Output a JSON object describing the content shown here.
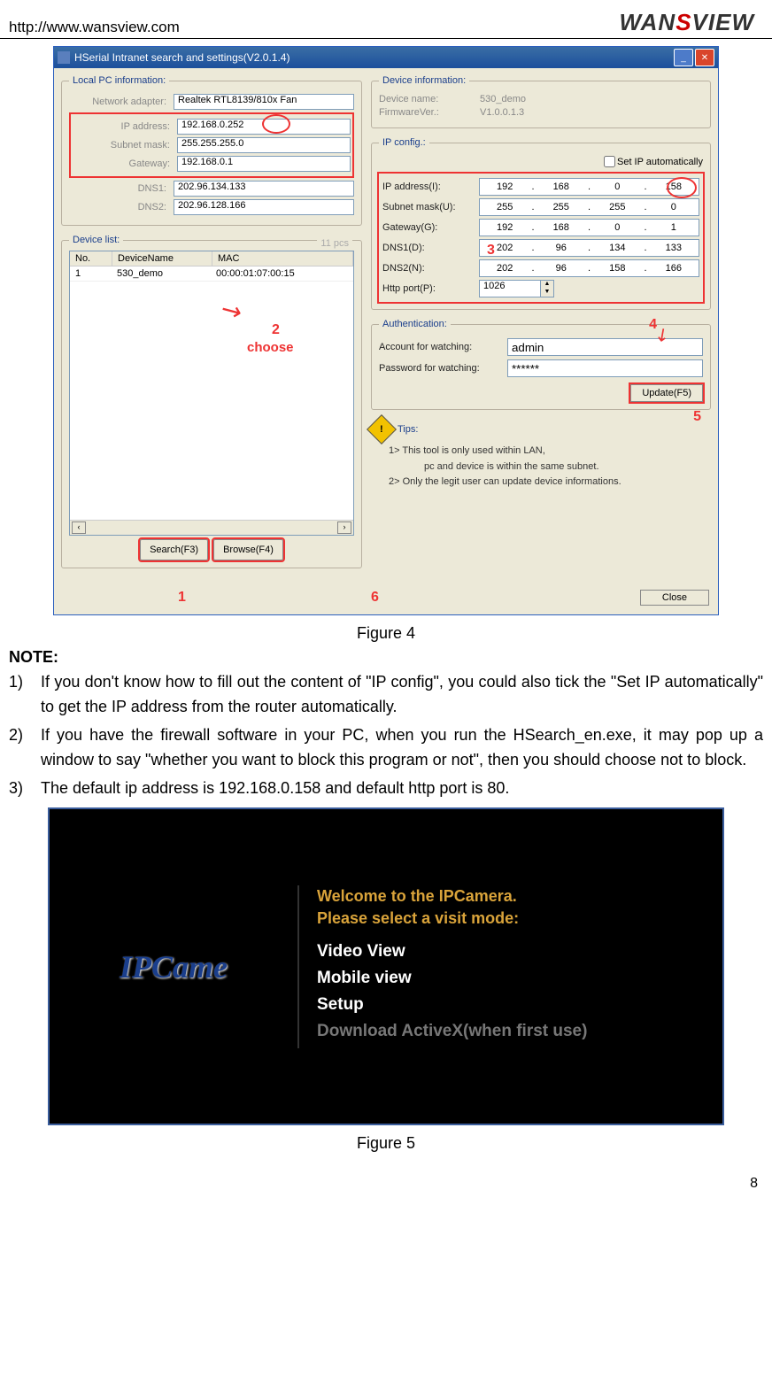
{
  "header": {
    "url": "http://www.wansview.com",
    "logo_part1": "WAN",
    "logo_part2": "S",
    "logo_part3": "VIEW"
  },
  "app": {
    "title": "HSerial Intranet search and settings(V2.0.1.4)",
    "local_pc": {
      "legend": "Local PC information:",
      "adapter_label": "Network adapter:",
      "adapter_value": "Realtek RTL8139/810x Fan",
      "ip_label": "IP address:",
      "ip_value": "192.168.0.252",
      "subnet_label": "Subnet mask:",
      "subnet_value": "255.255.255.0",
      "gateway_label": "Gateway:",
      "gateway_value": "192.168.0.1",
      "dns1_label": "DNS1:",
      "dns1_value": "202.96.134.133",
      "dns2_label": "DNS2:",
      "dns2_value": "202.96.128.166"
    },
    "device_list": {
      "legend": "Device list:",
      "count": "11 pcs",
      "columns": {
        "no": "No.",
        "name": "DeviceName",
        "mac": "MAC"
      },
      "rows": [
        {
          "no": "1",
          "name": "530_demo",
          "mac": "00:00:01:07:00:15"
        }
      ],
      "search_btn": "Search(F3)",
      "browse_btn": "Browse(F4)"
    },
    "device_info": {
      "legend": "Device information:",
      "name_label": "Device name:",
      "name_value": "530_demo",
      "fw_label": "FirmwareVer.:",
      "fw_value": "V1.0.0.1.3"
    },
    "ip_config": {
      "legend": "IP config.:",
      "auto_label": "Set IP automatically",
      "ip_label": "IP address(I):",
      "ip": [
        "192",
        "168",
        "0",
        "158"
      ],
      "subnet_label": "Subnet mask(U):",
      "subnet": [
        "255",
        "255",
        "255",
        "0"
      ],
      "gateway_label": "Gateway(G):",
      "gateway": [
        "192",
        "168",
        "0",
        "1"
      ],
      "dns1_label": "DNS1(D):",
      "dns1": [
        "202",
        "96",
        "134",
        "133"
      ],
      "dns2_label": "DNS2(N):",
      "dns2": [
        "202",
        "96",
        "158",
        "166"
      ],
      "port_label": "Http port(P):",
      "port_value": "1026"
    },
    "auth": {
      "legend": "Authentication:",
      "account_label": "Account for watching:",
      "account_value": "admin",
      "password_label": "Password for watching:",
      "password_value": "******",
      "update_btn": "Update(F5)"
    },
    "tips": {
      "label": "Tips:",
      "line1": "1> This tool is only used within LAN,",
      "line1b": "pc and device is within the same subnet.",
      "line2": "2> Only the legit user can update  device informations."
    },
    "close_btn": "Close"
  },
  "annotations": {
    "n1": "1",
    "n2": "2",
    "n3": "3",
    "n4": "4",
    "n5": "5",
    "n6": "6",
    "choose": "choose"
  },
  "captions": {
    "fig4": "Figure 4",
    "fig5": "Figure 5"
  },
  "note": {
    "heading": "NOTE:",
    "items": [
      "If you don't know how to fill out the content of \"IP config\", you could also tick the \"Set IP automatically\" to get the IP address from the router automatically.",
      "If you have the firewall software in your PC, when you run the HSearch_en.exe, it may pop up a window to say \"whether you want to block this program or not\", then you should choose not to block.",
      "The default ip address is 192.168.0.158 and default http port is 80."
    ]
  },
  "fig5": {
    "logo": "IPCame",
    "welcome1": "Welcome to the IPCamera.",
    "welcome2": "Please select a visit mode:",
    "link1": "Video View",
    "link2": "Mobile view",
    "link3": "Setup",
    "link4": "Download ActiveX(when first use)"
  },
  "page_number": "8"
}
